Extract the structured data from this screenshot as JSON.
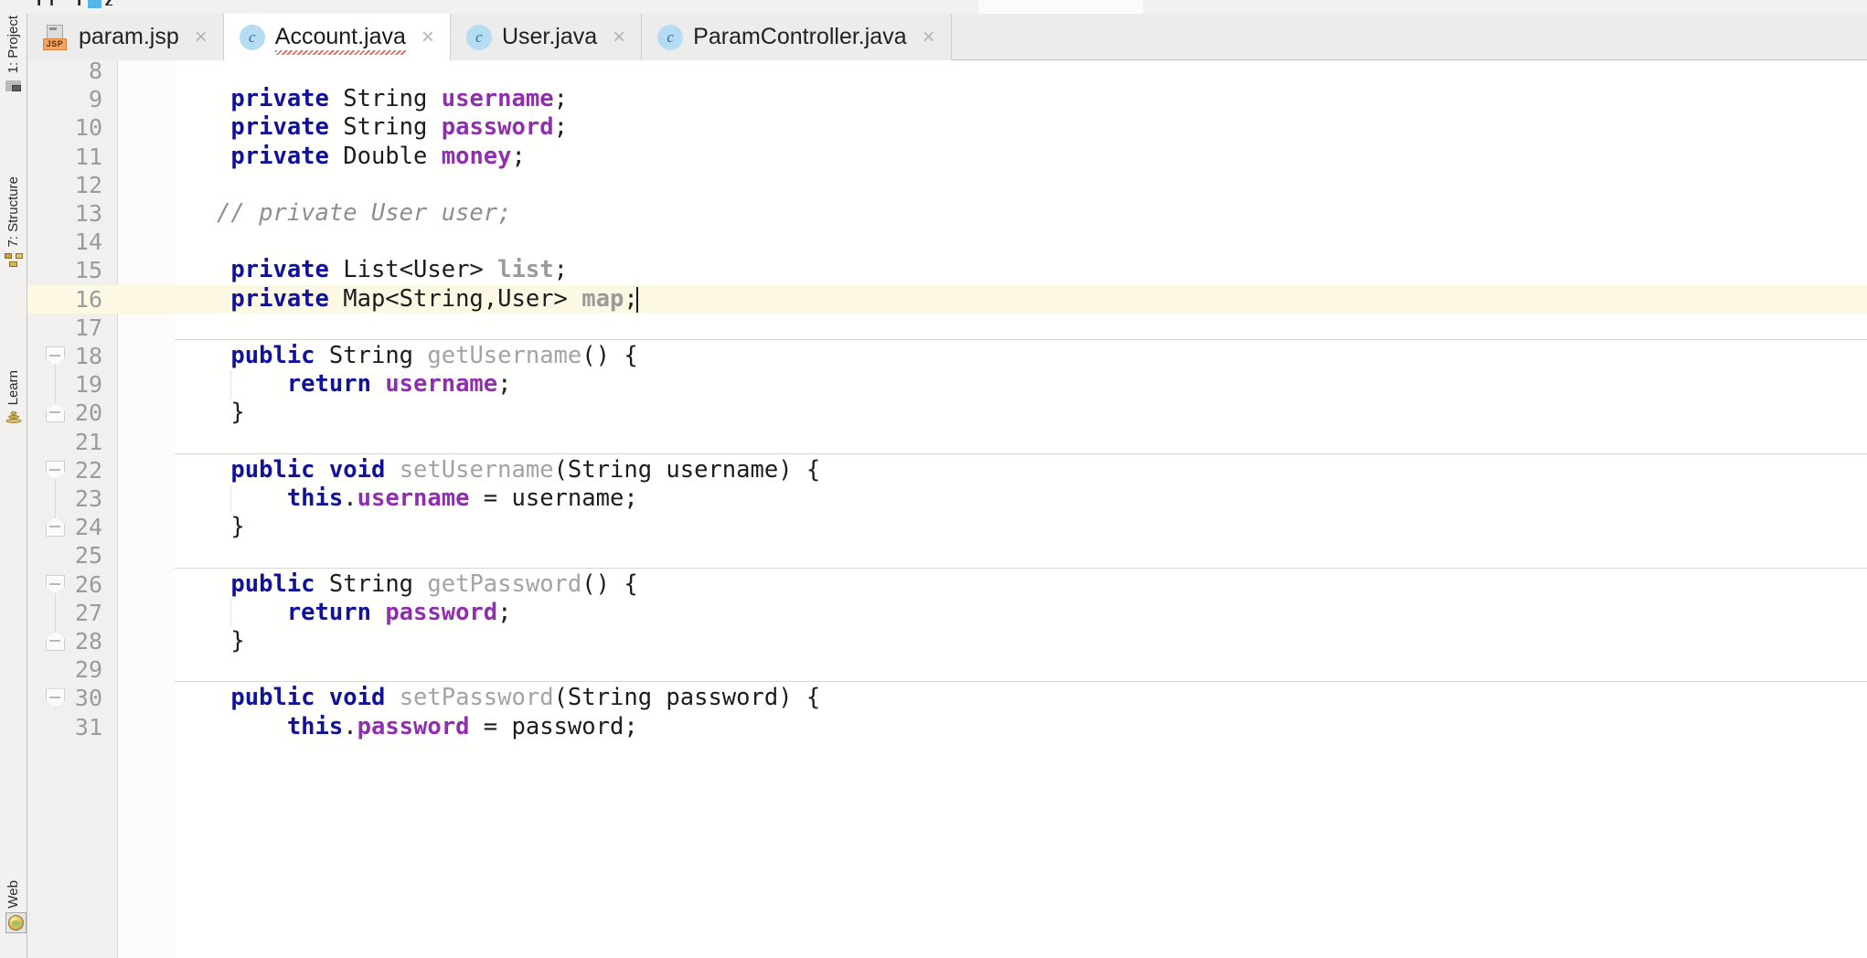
{
  "window": {
    "app": "IntelliJ IDEA",
    "theme_accent": "#b5dcf2",
    "editor_bg": "#fffffe",
    "gutter_bg": "#f0f0ef",
    "current_line_bg": "#fdf8e4",
    "tabbar_bg": "#ececec",
    "active_tab_bg": "#ffffff"
  },
  "left_stripe": {
    "items": [
      {
        "label": "1: Project",
        "icon": "project-icon",
        "name": "project"
      },
      {
        "label": "7: Structure",
        "icon": "structure-icon",
        "name": "structure"
      },
      {
        "label": "Learn",
        "icon": "learn-icon",
        "name": "learn"
      }
    ],
    "bottom_items": [
      {
        "label": "Web",
        "icon": "web-globe-icon",
        "name": "web"
      }
    ]
  },
  "editor_tabs": {
    "items": [
      {
        "label": "param.jsp",
        "icon": "jsp-file-icon",
        "close": "×",
        "active": false
      },
      {
        "label": "Account.java",
        "icon": "java-class-icon",
        "close": "×",
        "active": true
      },
      {
        "label": "User.java",
        "icon": "java-class-icon",
        "close": "×",
        "active": false
      },
      {
        "label": "ParamController.java",
        "icon": "java-class-icon",
        "close": "×",
        "active": false
      }
    ],
    "java_icon_letter": "c",
    "jsp_icon_badge": "JSP"
  },
  "editor": {
    "filename": "Account.java",
    "caret_line": 16,
    "caret_column": 30,
    "first_visible_line": 8,
    "lines": [
      {
        "n": 8,
        "tokens": []
      },
      {
        "n": 9,
        "tokens": [
          {
            "t": "    ",
            "c": "pl"
          },
          {
            "t": "private",
            "c": "kw"
          },
          {
            "t": " ",
            "c": "pl"
          },
          {
            "t": "String",
            "c": "ty"
          },
          {
            "t": " ",
            "c": "pl"
          },
          {
            "t": "username",
            "c": "fld"
          },
          {
            "t": ";",
            "c": "pl"
          }
        ]
      },
      {
        "n": 10,
        "tokens": [
          {
            "t": "    ",
            "c": "pl"
          },
          {
            "t": "private",
            "c": "kw"
          },
          {
            "t": " ",
            "c": "pl"
          },
          {
            "t": "String",
            "c": "ty"
          },
          {
            "t": " ",
            "c": "pl"
          },
          {
            "t": "password",
            "c": "fld"
          },
          {
            "t": ";",
            "c": "pl"
          }
        ]
      },
      {
        "n": 11,
        "tokens": [
          {
            "t": "    ",
            "c": "pl"
          },
          {
            "t": "private",
            "c": "kw"
          },
          {
            "t": " ",
            "c": "pl"
          },
          {
            "t": "Double",
            "c": "ty"
          },
          {
            "t": " ",
            "c": "pl"
          },
          {
            "t": "money",
            "c": "fld"
          },
          {
            "t": ";",
            "c": "pl"
          }
        ]
      },
      {
        "n": 12,
        "tokens": []
      },
      {
        "n": 13,
        "tokens": [
          {
            "t": "   // private User user;",
            "c": "cmt"
          }
        ]
      },
      {
        "n": 14,
        "tokens": []
      },
      {
        "n": 15,
        "tokens": [
          {
            "t": "    ",
            "c": "pl"
          },
          {
            "t": "private",
            "c": "kw"
          },
          {
            "t": " ",
            "c": "pl"
          },
          {
            "t": "List<User>",
            "c": "ty"
          },
          {
            "t": " ",
            "c": "pl"
          },
          {
            "t": "list",
            "c": "fld-dim"
          },
          {
            "t": ";",
            "c": "pl"
          }
        ]
      },
      {
        "n": 16,
        "tokens": [
          {
            "t": "    ",
            "c": "pl"
          },
          {
            "t": "private",
            "c": "kw"
          },
          {
            "t": " ",
            "c": "pl"
          },
          {
            "t": "Map<String,User>",
            "c": "ty"
          },
          {
            "t": " ",
            "c": "pl"
          },
          {
            "t": "map",
            "c": "fld-dim"
          },
          {
            "t": ";",
            "c": "pl"
          }
        ],
        "highlight": true,
        "caret_after": true
      },
      {
        "n": 17,
        "tokens": []
      },
      {
        "n": 18,
        "tokens": [
          {
            "t": "    ",
            "c": "pl"
          },
          {
            "t": "public",
            "c": "kw"
          },
          {
            "t": " ",
            "c": "pl"
          },
          {
            "t": "String",
            "c": "ty"
          },
          {
            "t": " ",
            "c": "pl"
          },
          {
            "t": "getUsername",
            "c": "mth"
          },
          {
            "t": "() {",
            "c": "pl"
          }
        ],
        "separator_above": true,
        "fold_start": true
      },
      {
        "n": 19,
        "tokens": [
          {
            "t": "        ",
            "c": "pl"
          },
          {
            "t": "return",
            "c": "kw"
          },
          {
            "t": " ",
            "c": "pl"
          },
          {
            "t": "username",
            "c": "fld"
          },
          {
            "t": ";",
            "c": "pl"
          }
        ]
      },
      {
        "n": 20,
        "tokens": [
          {
            "t": "    }",
            "c": "pl"
          }
        ],
        "fold_end": true
      },
      {
        "n": 21,
        "tokens": []
      },
      {
        "n": 22,
        "tokens": [
          {
            "t": "    ",
            "c": "pl"
          },
          {
            "t": "public",
            "c": "kw"
          },
          {
            "t": " ",
            "c": "pl"
          },
          {
            "t": "void",
            "c": "kw"
          },
          {
            "t": " ",
            "c": "pl"
          },
          {
            "t": "setUsername",
            "c": "mth"
          },
          {
            "t": "(String username) {",
            "c": "pl"
          }
        ],
        "separator_above": true,
        "fold_start": true
      },
      {
        "n": 23,
        "tokens": [
          {
            "t": "        ",
            "c": "pl"
          },
          {
            "t": "this",
            "c": "kw"
          },
          {
            "t": ".",
            "c": "pl"
          },
          {
            "t": "username",
            "c": "fld"
          },
          {
            "t": " = username;",
            "c": "pl"
          }
        ]
      },
      {
        "n": 24,
        "tokens": [
          {
            "t": "    }",
            "c": "pl"
          }
        ],
        "fold_end": true
      },
      {
        "n": 25,
        "tokens": []
      },
      {
        "n": 26,
        "tokens": [
          {
            "t": "    ",
            "c": "pl"
          },
          {
            "t": "public",
            "c": "kw"
          },
          {
            "t": " ",
            "c": "pl"
          },
          {
            "t": "String",
            "c": "ty"
          },
          {
            "t": " ",
            "c": "pl"
          },
          {
            "t": "getPassword",
            "c": "mth"
          },
          {
            "t": "() {",
            "c": "pl"
          }
        ],
        "separator_above": true,
        "fold_start": true
      },
      {
        "n": 27,
        "tokens": [
          {
            "t": "        ",
            "c": "pl"
          },
          {
            "t": "return",
            "c": "kw"
          },
          {
            "t": " ",
            "c": "pl"
          },
          {
            "t": "password",
            "c": "fld"
          },
          {
            "t": ";",
            "c": "pl"
          }
        ]
      },
      {
        "n": 28,
        "tokens": [
          {
            "t": "    }",
            "c": "pl"
          }
        ],
        "fold_end": true
      },
      {
        "n": 29,
        "tokens": []
      },
      {
        "n": 30,
        "tokens": [
          {
            "t": "    ",
            "c": "pl"
          },
          {
            "t": "public",
            "c": "kw"
          },
          {
            "t": " ",
            "c": "pl"
          },
          {
            "t": "void",
            "c": "kw"
          },
          {
            "t": " ",
            "c": "pl"
          },
          {
            "t": "setPassword",
            "c": "mth"
          },
          {
            "t": "(String password) {",
            "c": "pl"
          }
        ],
        "separator_above": true,
        "fold_start": true
      },
      {
        "n": 31,
        "tokens": [
          {
            "t": "        ",
            "c": "pl"
          },
          {
            "t": "this",
            "c": "kw"
          },
          {
            "t": ".",
            "c": "pl"
          },
          {
            "t": "password",
            "c": "fld"
          },
          {
            "t": " = password;",
            "c": "pl"
          }
        ]
      }
    ]
  }
}
